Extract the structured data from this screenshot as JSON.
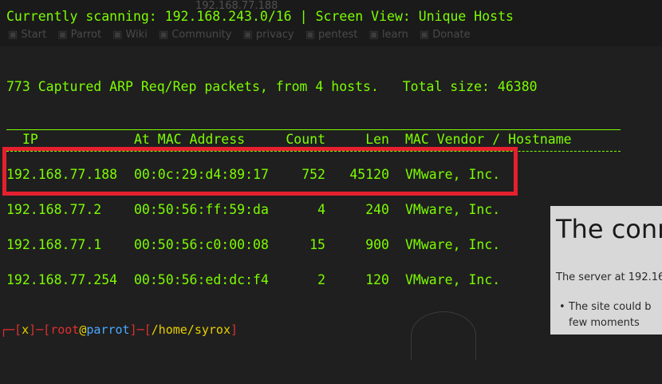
{
  "background": {
    "tab_title": "192.168.77.188",
    "bookmarks": [
      "Start",
      "Parrot",
      "Wiki",
      "Community",
      "privacy",
      "pentest",
      "learn",
      "Donate"
    ],
    "heading": "The conn",
    "paragraph": "The server at 192.16",
    "list_item_lines": [
      "The site could b",
      "few moments"
    ]
  },
  "netdiscover": {
    "scan_label": "Currently scanning: 192.168.243.0/16",
    "separator": "|",
    "view_label": "Screen View: Unique Hosts",
    "summary_left": "773 Captured ARP Req/Rep packets, from 4 hosts.",
    "summary_right": "Total size: 46380",
    "columns": {
      "ip": "IP",
      "mac": "At MAC Address",
      "count": "Count",
      "len": "Len",
      "vendor": "MAC Vendor / Hostname"
    },
    "rows": [
      {
        "ip": "192.168.77.188",
        "mac": "00:0c:29:d4:89:17",
        "count": "752",
        "len": "45120",
        "vendor": "VMware, Inc."
      },
      {
        "ip": "192.168.77.2",
        "mac": "00:50:56:ff:59:da",
        "count": "4",
        "len": "240",
        "vendor": "VMware, Inc."
      },
      {
        "ip": "192.168.77.1",
        "mac": "00:50:56:c0:00:08",
        "count": "15",
        "len": "900",
        "vendor": "VMware, Inc."
      },
      {
        "ip": "192.168.77.254",
        "mac": "00:50:56:ed:dc:f4",
        "count": "2",
        "len": "120",
        "vendor": "VMware, Inc."
      }
    ]
  },
  "prompt": {
    "prefix": "┌─[",
    "x": "x",
    "mid": "]─[",
    "user": "root",
    "at": "@",
    "host": "parrot",
    "mid2": "]─[",
    "path": "/home/syrox",
    "suffix": "]"
  },
  "colors": {
    "terminal_text": "#7cfc00",
    "highlight_box": "#e5202e",
    "background": "#1f1f1f"
  }
}
